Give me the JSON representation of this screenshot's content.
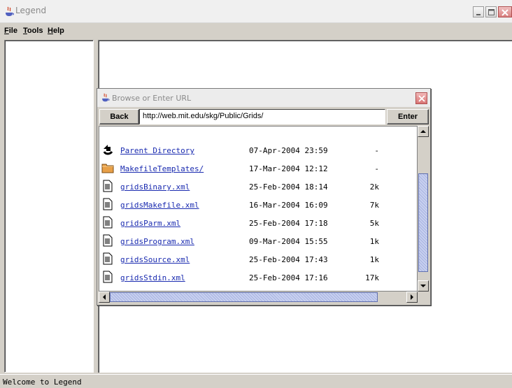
{
  "window": {
    "title": "Legend",
    "controls": {
      "minimize": "minimize",
      "maximize": "maximize",
      "close": "close"
    }
  },
  "menu": [
    {
      "label": "File"
    },
    {
      "label": "Tools"
    },
    {
      "label": "Help"
    }
  ],
  "status": {
    "text": "Welcome to Legend"
  },
  "dialog": {
    "title": "Browse or Enter URL",
    "back_label": "Back",
    "enter_label": "Enter",
    "url": "http://web.mit.edu/skg/Public/Grids/",
    "entries": [
      {
        "icon": "back-arrow-icon",
        "name": "Parent Directory",
        "date": "07-Apr-2004 23:59",
        "size": "-"
      },
      {
        "icon": "folder-icon",
        "name": "MakefileTemplates/",
        "date": "17-Mar-2004 12:12",
        "size": "-"
      },
      {
        "icon": "document-icon",
        "name": "gridsBinary.xml",
        "date": "25-Feb-2004 18:14",
        "size": "2k"
      },
      {
        "icon": "document-icon",
        "name": "gridsMakefile.xml",
        "date": "16-Mar-2004 16:09",
        "size": "7k"
      },
      {
        "icon": "document-icon",
        "name": "gridsParm.xml",
        "date": "25-Feb-2004 17:18",
        "size": "5k"
      },
      {
        "icon": "document-icon",
        "name": "gridsProgram.xml",
        "date": "09-Mar-2004 15:55",
        "size": "1k"
      },
      {
        "icon": "document-icon",
        "name": "gridsSource.xml",
        "date": "25-Feb-2004 17:43",
        "size": "1k"
      },
      {
        "icon": "document-icon",
        "name": "gridsStdin.xml",
        "date": "25-Feb-2004 17:16",
        "size": "17k"
      }
    ]
  }
}
